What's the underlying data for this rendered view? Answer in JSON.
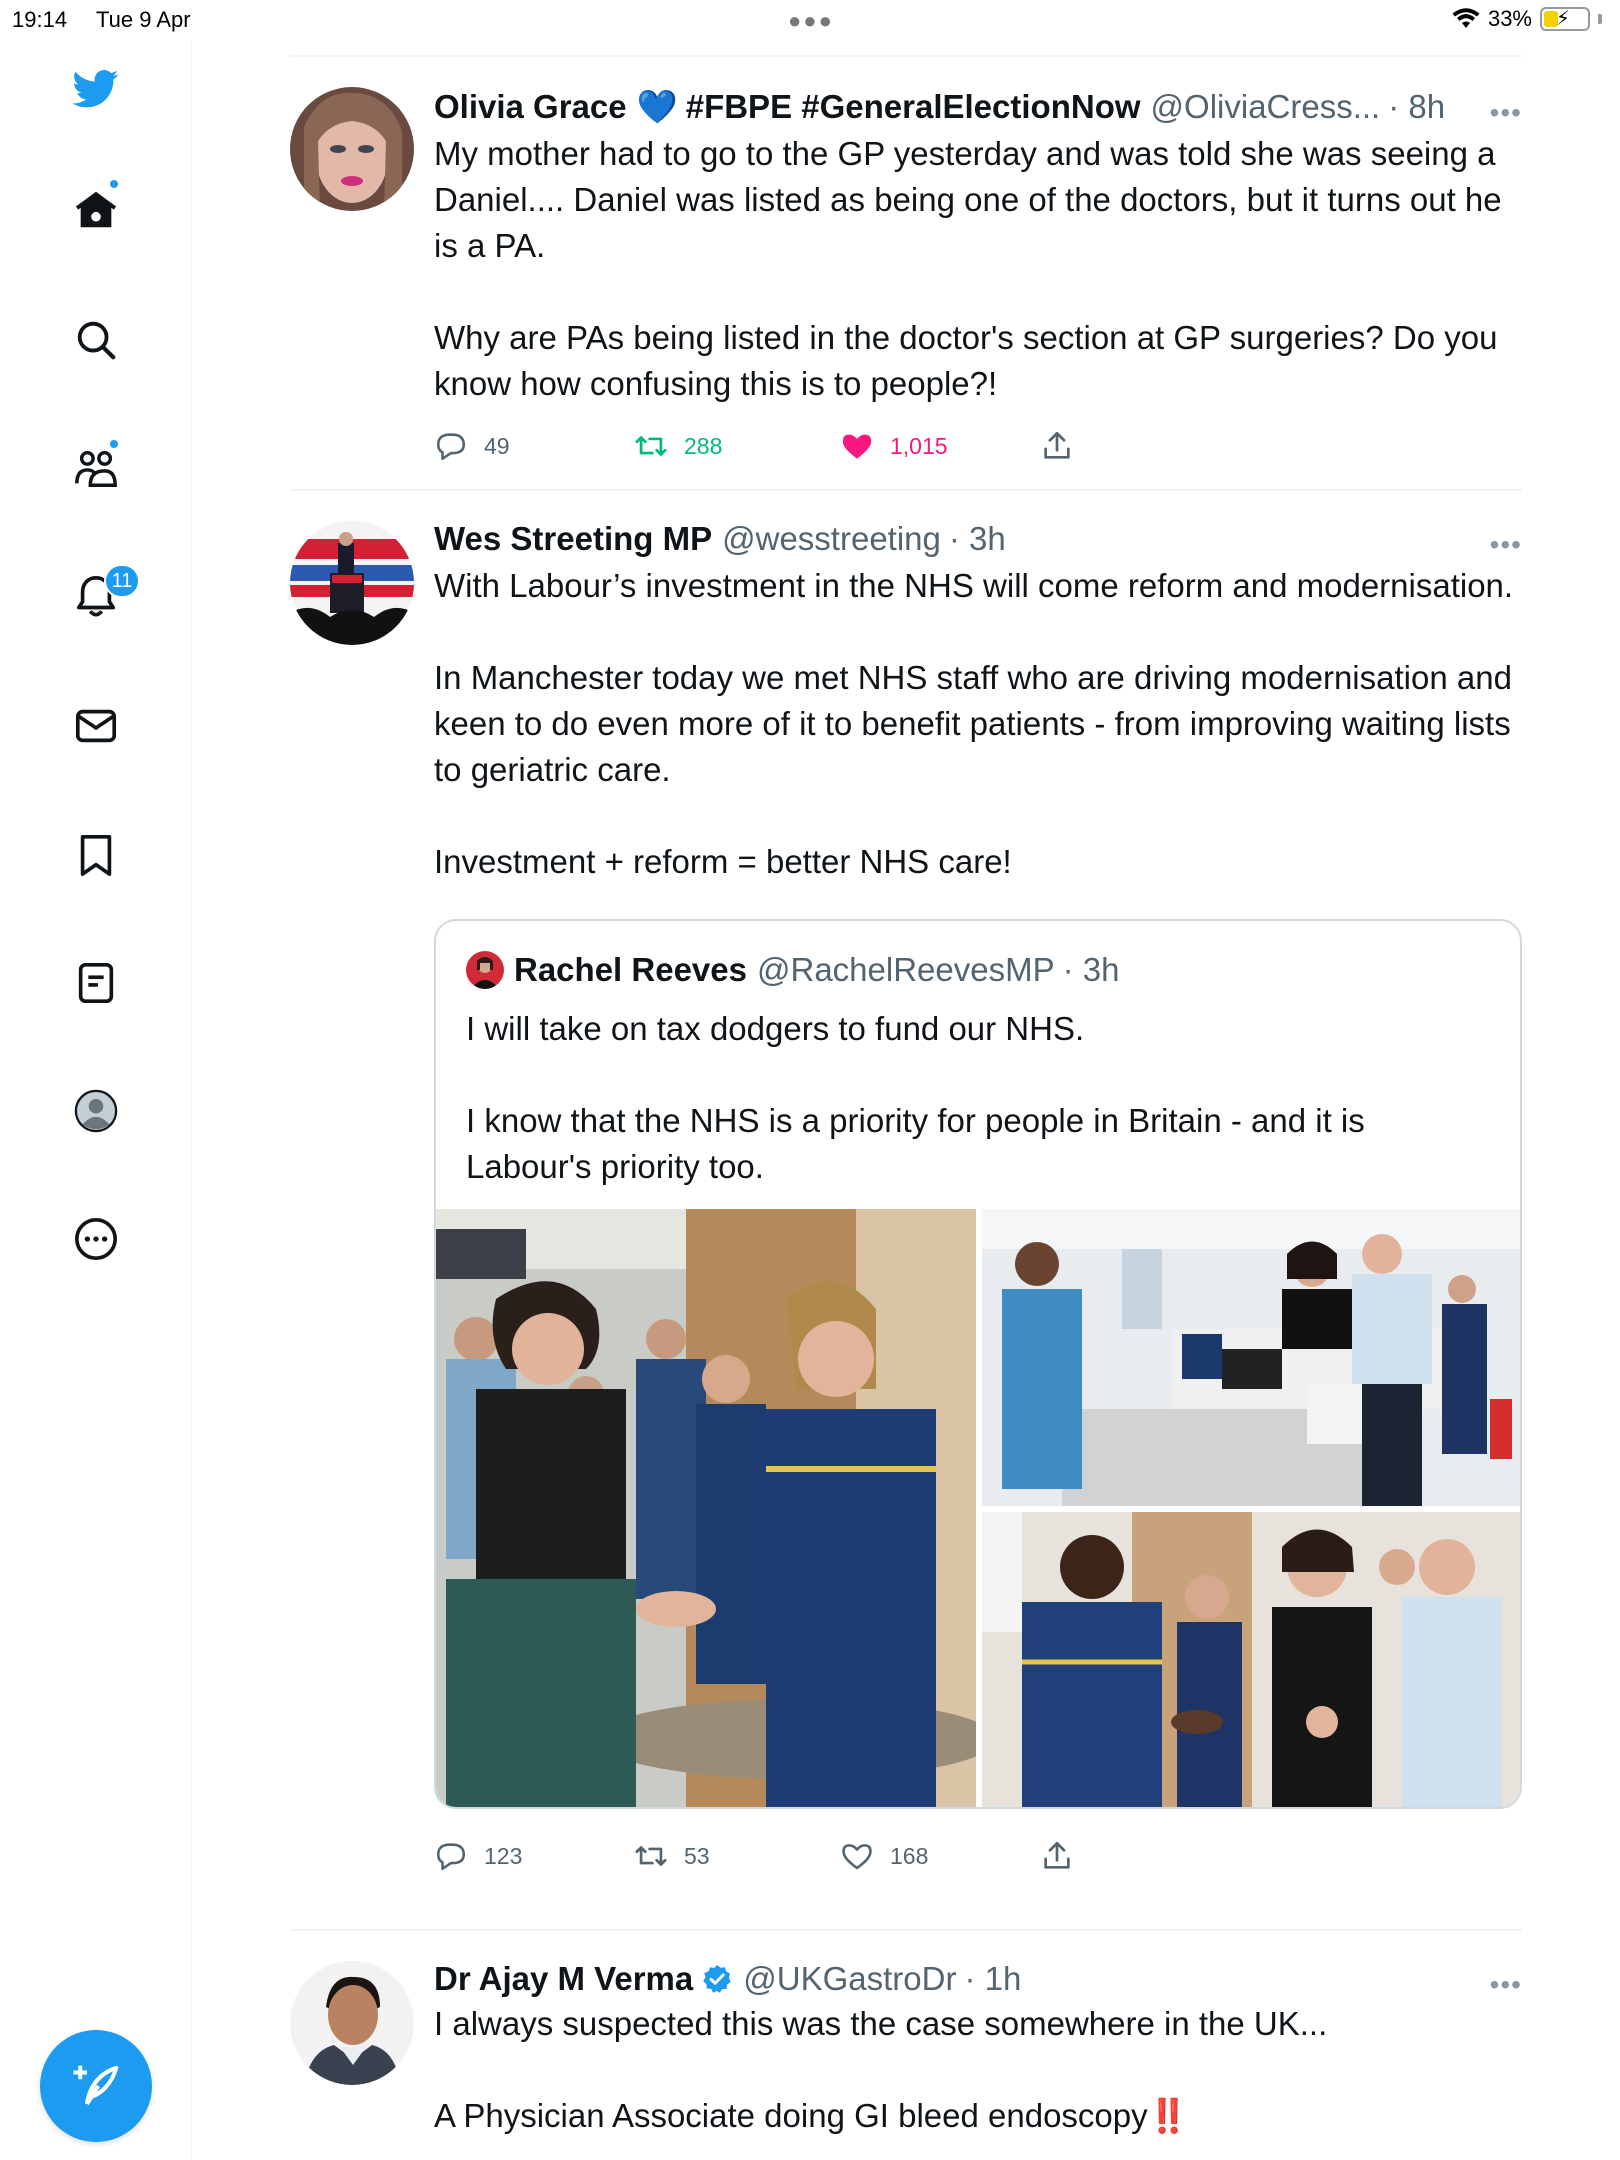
{
  "status_bar": {
    "time": "19:14",
    "date": "Tue 9 Apr",
    "battery_percent": "33%",
    "battery_level": 0.33
  },
  "sidebar": {
    "items": [
      {
        "name": "twitter-logo"
      },
      {
        "name": "home"
      },
      {
        "name": "explore"
      },
      {
        "name": "communities"
      },
      {
        "name": "notifications",
        "badge": "11"
      },
      {
        "name": "messages"
      },
      {
        "name": "bookmarks"
      },
      {
        "name": "lists"
      },
      {
        "name": "profile"
      },
      {
        "name": "more"
      }
    ]
  },
  "colors": {
    "accent": "#1d9bf0",
    "like": "#f91880",
    "retweet": "#00ba7c",
    "secondary": "#536471"
  },
  "tweets": [
    {
      "name": "Olivia Grace",
      "emoji": "💙",
      "hashtags": "#FBPE #GeneralElectionNow",
      "handle": "@OliviaCress...",
      "time": "· 8h",
      "text": "My mother had to go to the GP yesterday and was told she was seeing a Daniel.... Daniel was listed as being one of the doctors, but it turns out he is a PA.\n\nWhy are PAs being listed in the doctor's section at GP surgeries? Do you know how confusing this is to people?!",
      "replies": "49",
      "retweets": "288",
      "likes": "1,015"
    },
    {
      "name": "Wes Streeting MP",
      "handle": "@wesstreeting",
      "time": "· 3h",
      "text": "With Labour’s investment in the NHS will come reform and modernisation.\n\nIn Manchester today we met NHS staff who are driving modernisation and keen to do even more of it to benefit patients - from improving waiting lists to geriatric care.\n\nInvestment + reform = better NHS care!",
      "quote": {
        "name": "Rachel Reeves",
        "handle": "@RachelReevesMP",
        "time": "· 3h",
        "text": "I will take on tax dodgers to fund our NHS.\n\nI know that the NHS is a priority for people in Britain - and it is Labour's priority too."
      },
      "replies": "123",
      "retweets": "53",
      "likes": "168"
    },
    {
      "name": "Dr Ajay M Verma",
      "handle": "@UKGastroDr",
      "time": "· 1h",
      "text": "I always suspected this was the case somewhere in the UK...\n\nA Physician Associate doing GI bleed endoscopy",
      "emoji": "‼️"
    }
  ]
}
